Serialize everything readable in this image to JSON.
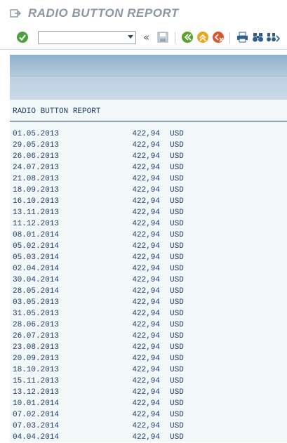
{
  "window": {
    "title": "RADIO BUTTON REPORT"
  },
  "toolbar": {
    "command_value": "",
    "icons": [
      "enter-check-icon",
      "save-icon",
      "back-icon",
      "exit-icon",
      "cancel-icon",
      "print-icon",
      "find-icon",
      "find-next-icon"
    ]
  },
  "report": {
    "title": "RADIO BUTTON REPORT",
    "rows": [
      {
        "date": "01.05.2013",
        "amount": "422,94",
        "currency": "USD"
      },
      {
        "date": "29.05.2013",
        "amount": "422,94",
        "currency": "USD"
      },
      {
        "date": "26.06.2013",
        "amount": "422,94",
        "currency": "USD"
      },
      {
        "date": "24.07.2013",
        "amount": "422,94",
        "currency": "USD"
      },
      {
        "date": "21.08.2013",
        "amount": "422,94",
        "currency": "USD"
      },
      {
        "date": "18.09.2013",
        "amount": "422,94",
        "currency": "USD"
      },
      {
        "date": "16.10.2013",
        "amount": "422,94",
        "currency": "USD"
      },
      {
        "date": "13.11.2013",
        "amount": "422,94",
        "currency": "USD"
      },
      {
        "date": "11.12.2013",
        "amount": "422,94",
        "currency": "USD"
      },
      {
        "date": "08.01.2014",
        "amount": "422,94",
        "currency": "USD"
      },
      {
        "date": "05.02.2014",
        "amount": "422,94",
        "currency": "USD"
      },
      {
        "date": "05.03.2014",
        "amount": "422,94",
        "currency": "USD"
      },
      {
        "date": "02.04.2014",
        "amount": "422,94",
        "currency": "USD"
      },
      {
        "date": "30.04.2014",
        "amount": "422,94",
        "currency": "USD"
      },
      {
        "date": "28.05.2014",
        "amount": "422,94",
        "currency": "USD"
      },
      {
        "date": "03.05.2013",
        "amount": "422,94",
        "currency": "USD"
      },
      {
        "date": "31.05.2013",
        "amount": "422,94",
        "currency": "USD"
      },
      {
        "date": "28.06.2013",
        "amount": "422,94",
        "currency": "USD"
      },
      {
        "date": "26.07.2013",
        "amount": "422,94",
        "currency": "USD"
      },
      {
        "date": "23.08.2013",
        "amount": "422,94",
        "currency": "USD"
      },
      {
        "date": "20.09.2013",
        "amount": "422,94",
        "currency": "USD"
      },
      {
        "date": "18.10.2013",
        "amount": "422,94",
        "currency": "USD"
      },
      {
        "date": "15.11.2013",
        "amount": "422,94",
        "currency": "USD"
      },
      {
        "date": "13.12.2013",
        "amount": "422,94",
        "currency": "USD"
      },
      {
        "date": "10.01.2014",
        "amount": "422,94",
        "currency": "USD"
      },
      {
        "date": "07.02.2014",
        "amount": "422,94",
        "currency": "USD"
      },
      {
        "date": "07.03.2014",
        "amount": "422,94",
        "currency": "USD"
      },
      {
        "date": "04.04.2014",
        "amount": "422,94",
        "currency": "USD"
      }
    ]
  }
}
